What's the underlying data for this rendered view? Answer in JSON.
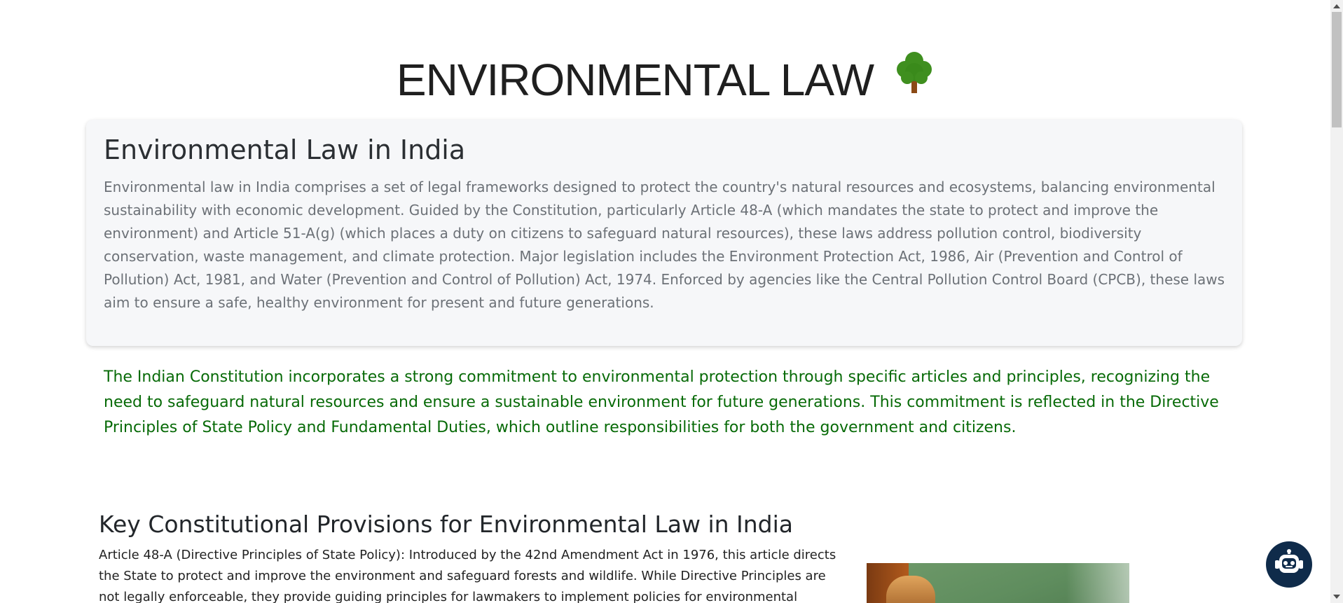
{
  "header": {
    "title": "ENVIRONMENTAL LAW",
    "icon": "tree-icon"
  },
  "intro_card": {
    "heading": "Environmental Law in India",
    "body": "Environmental law in India comprises a set of legal frameworks designed to protect the country's natural resources and ecosystems, balancing environmental sustainability with economic development. Guided by the Constitution, particularly Article 48-A (which mandates the state to protect and improve the environment) and Article 51-A(g) (which places a duty on citizens to safeguard natural resources), these laws address pollution control, biodiversity conservation, waste management, and climate protection. Major legislation includes the Environment Protection Act, 1986, Air (Prevention and Control of Pollution) Act, 1981, and Water (Prevention and Control of Pollution) Act, 1974. Enforced by agencies like the Central Pollution Control Board (CPCB), these laws aim to ensure a safe, healthy environment for present and future generations."
  },
  "commitment": {
    "text": "The Indian Constitution incorporates a strong commitment to environmental protection through specific articles and principles, recognizing the need to safeguard natural resources and ensure a sustainable environment for future generations. This commitment is reflected in the Directive Principles of State Policy and Fundamental Duties, which outline responsibilities for both the government and citizens."
  },
  "provisions": {
    "heading": "Key Constitutional Provisions for Environmental Law in India",
    "article_48a": "Article 48-A (Directive Principles of State Policy): Introduced by the 42nd Amendment Act in 1976, this article directs the State to protect and improve the environment and safeguard forests and wildlife. While Directive Principles are not legally enforceable, they provide guiding principles for lawmakers to implement policies for environmental conservation."
  },
  "image": {
    "icon": "gavel-image"
  },
  "chatbot": {
    "icon": "robot-icon"
  },
  "colors": {
    "commitment_text": "#076a07",
    "chatbot_bg": "#0f2b4a",
    "card_bg": "#f6f7f9",
    "tree_green": "#3f8f1f",
    "tree_trunk": "#8b4a16"
  }
}
